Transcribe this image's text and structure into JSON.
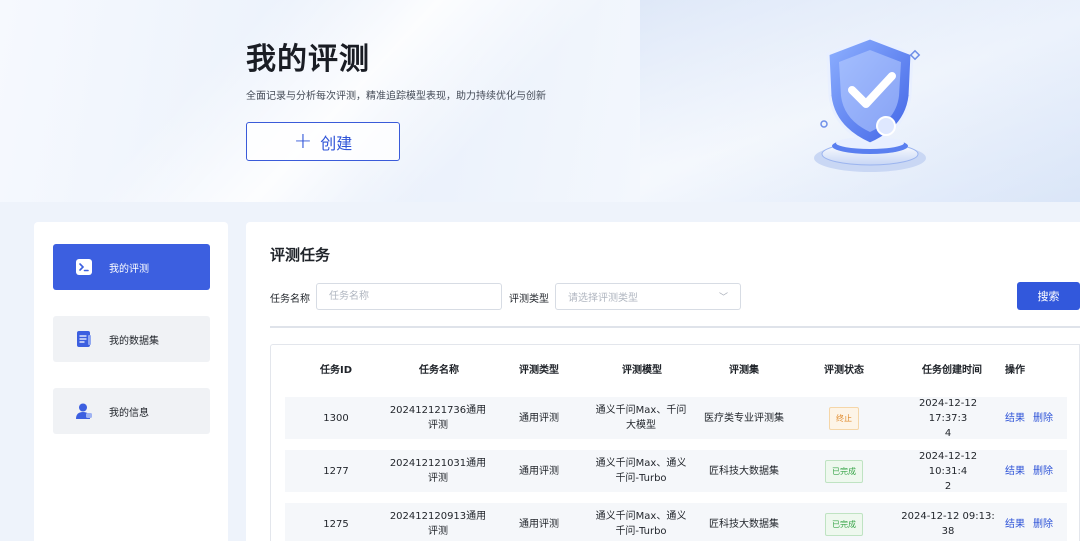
{
  "hero": {
    "title": "我的评测",
    "subtitle": "全面记录与分析每次评测，精准追踪模型表现，助力持续优化与创新",
    "create_label": "创建"
  },
  "sidebar": {
    "items": [
      {
        "label": "我的评测",
        "icon": "terminal-icon",
        "active": true
      },
      {
        "label": "我的数据集",
        "icon": "document-icon",
        "active": false
      },
      {
        "label": "我的信息",
        "icon": "user-icon",
        "active": false
      }
    ]
  },
  "main": {
    "section_title": "评测任务",
    "filters": {
      "task_name_label": "任务名称",
      "task_name_placeholder": "任务名称",
      "eval_type_label": "评测类型",
      "eval_type_placeholder": "请选择评测类型",
      "search_label": "搜索"
    },
    "table": {
      "columns": [
        "任务ID",
        "任务名称",
        "评测类型",
        "评测模型",
        "评测集",
        "评测状态",
        "任务创建时间",
        "操作"
      ],
      "rows": [
        {
          "id": "1300",
          "name_l1": "202412121736通用",
          "name_l2": "评测",
          "type": "通用评测",
          "model_l1": "通义千问Max、千问",
          "model_l2": "大模型",
          "dataset": "医疗类专业评测集",
          "status": "终止",
          "status_kind": "stop",
          "time_l1": "2024-12-12 17:37:3",
          "time_l2": "4",
          "op_result": "结果",
          "op_delete": "删除"
        },
        {
          "id": "1277",
          "name_l1": "202412121031通用",
          "name_l2": "评测",
          "type": "通用评测",
          "model_l1": "通义千问Max、通义",
          "model_l2": "千问-Turbo",
          "dataset": "匠科技大数据集",
          "status": "已完成",
          "status_kind": "done",
          "time_l1": "2024-12-12 10:31:4",
          "time_l2": "2",
          "op_result": "结果",
          "op_delete": "删除"
        },
        {
          "id": "1275",
          "name_l1": "202412120913通用",
          "name_l2": "评测",
          "type": "通用评测",
          "model_l1": "通义千问Max、通义",
          "model_l2": "千问-Turbo",
          "dataset": "匠科技大数据集",
          "status": "已完成",
          "status_kind": "done",
          "time_l1": "2024-12-12 09:13:",
          "time_l2": "38",
          "op_result": "结果",
          "op_delete": "删除"
        }
      ]
    }
  },
  "colors": {
    "accent": "#3c5fe0",
    "status_stop": "#e08a2c",
    "status_done": "#3aa64a"
  }
}
